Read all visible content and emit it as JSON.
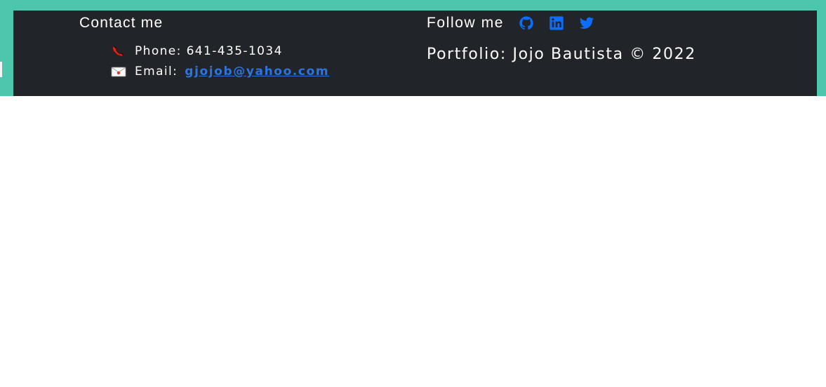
{
  "colors": {
    "page_background": "#ffffff",
    "band_accent": "#4cc6ad",
    "footer_background": "#212529",
    "footer_text": "#ffffff",
    "link": "#2b74e2",
    "social_icon": "#0d6efd"
  },
  "contact": {
    "heading": "Contact me",
    "phone": {
      "icon": "telephone-icon",
      "label": "Phone: 641-435-1034"
    },
    "email": {
      "icon": "envelope-icon",
      "label": "Email:",
      "address": "gjojob@yahoo.com",
      "href": "mailto:gjojob@yahoo.com"
    }
  },
  "follow": {
    "heading": "Follow me",
    "icons": [
      "github-icon",
      "linkedin-icon",
      "twitter-icon"
    ]
  },
  "copyright": "Portfolio: Jojo Bautista © 2022"
}
